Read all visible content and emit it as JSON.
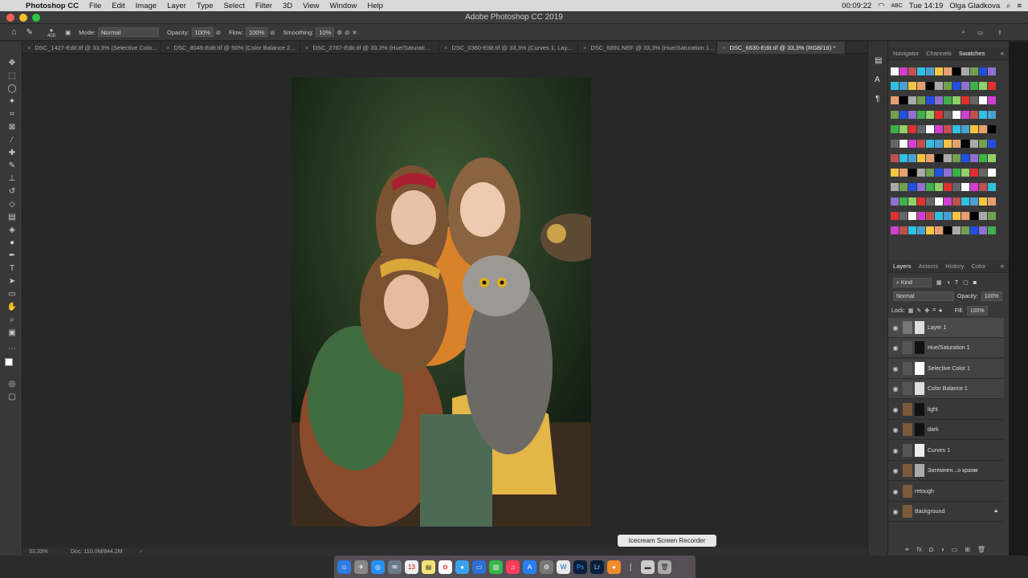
{
  "menubar": {
    "app": "Photoshop CC",
    "items": [
      "File",
      "Edit",
      "Image",
      "Layer",
      "Type",
      "Select",
      "Filter",
      "3D",
      "View",
      "Window",
      "Help"
    ],
    "timer": "00:09:22",
    "keyboard": "ABC",
    "clock": "Tue 14:19",
    "user": "Olga Gladkova"
  },
  "window": {
    "title": "Adobe Photoshop CC 2019"
  },
  "options": {
    "brush_size": "400",
    "mode_label": "Mode:",
    "mode_value": "Normal",
    "opacity_label": "Opacity:",
    "opacity_value": "100%",
    "flow_label": "Flow:",
    "flow_value": "100%",
    "smoothing_label": "Smoothing:",
    "smoothing_value": "10%"
  },
  "tabs": [
    "DSC_1427-Edit.tif @ 33,3% (Selective Colo...",
    "DSC_8046-Edit.tif @ 50% (Color Balance 2...",
    "DSC_2767-Edit.tif @ 33,3% (Hue/Saturati...",
    "DSC_0360-Edit.tif @ 33,3% (Curves 1, Lay...",
    "DSC_6691.NEF @ 33,3% (Hue/Saturation 1...",
    "DSC_6630-Edit.tif @ 33,3% (RGB/16) *"
  ],
  "status": {
    "zoom": "33,33%",
    "doc": "Doc: 110,0M/844,2M"
  },
  "top_panel": {
    "tabs": [
      "Navigator",
      "Channels",
      "Swatches"
    ]
  },
  "layers_panel": {
    "tabs": [
      "Layers",
      "Actions",
      "History",
      "Color"
    ],
    "filter": "Kind",
    "blend": "Normal",
    "opacity_label": "Opacity:",
    "opacity_value": "100%",
    "lock_label": "Lock:",
    "fill_label": "Fill:",
    "fill_value": "100%",
    "layers": [
      "Layer 1",
      "Hue/Saturation 1",
      "Selective Color 1",
      "Color Balance 1",
      "light",
      "dark",
      "Curves 1",
      "Затемнен...о краям",
      "retough",
      "Background"
    ]
  },
  "tooltip": "Icecream Screen Recorder",
  "colors": {
    "accent": "#3b83f6",
    "panel": "#383838",
    "canvas": "#282828"
  }
}
